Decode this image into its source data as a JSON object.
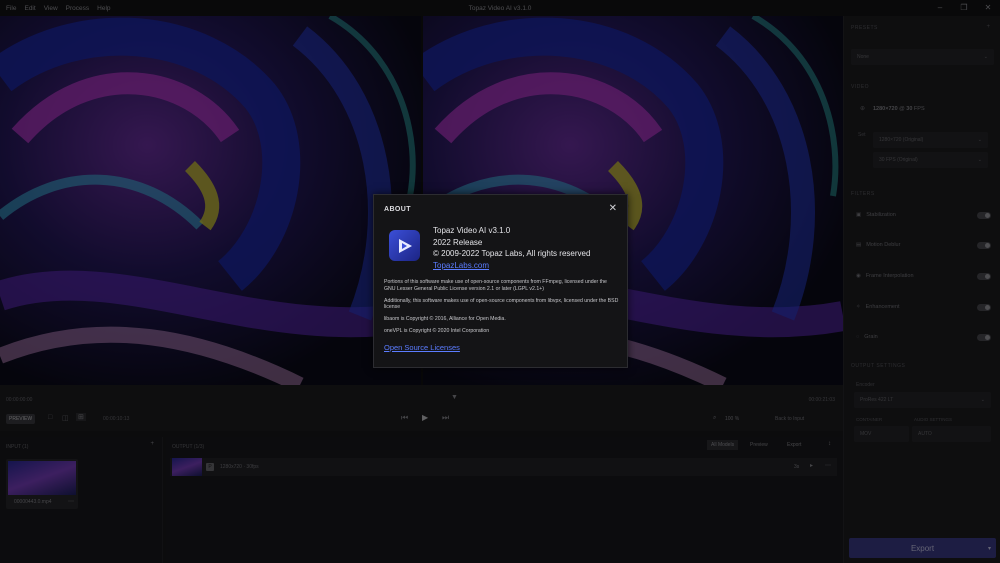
{
  "window": {
    "title": "Topaz Video AI v3.1.0",
    "menu": [
      "File",
      "Edit",
      "View",
      "Process",
      "Help"
    ],
    "controls": [
      "–",
      "❐",
      "✕"
    ]
  },
  "timeline": {
    "start": "00:00:00:00",
    "end": "00:00:21:03"
  },
  "controls": {
    "preview": "PREVIEW",
    "compare_modes": [
      "□",
      "◫",
      "⊞"
    ],
    "duration": "00:00:10:13",
    "zoom": "100 %",
    "back_to_input": "Back to Input"
  },
  "input": {
    "header": "INPUT (1)",
    "clip_name": "00000443.0.mp4"
  },
  "output": {
    "header": "OUTPUT (1/3)",
    "tabs": [
      "All Models",
      "Preview",
      "Export"
    ],
    "row_label": "1280x720 · 30fps",
    "row_badge": "3s"
  },
  "sidebar": {
    "presets_header": "PRESETS",
    "preset_value": "None",
    "video_header": "VIDEO",
    "video_res": "1280×720",
    "video_fps": "30",
    "video_fps_unit": "FPS",
    "set_label": "Set",
    "out_res": "1280×720 (Original)",
    "out_fps": "30 FPS (Original)",
    "filters_header": "FILTERS",
    "filters": [
      "Stabilization",
      "Motion Deblur",
      "Frame Interpolation",
      "Enhancement",
      "Grain"
    ],
    "output_settings_header": "OUTPUT SETTINGS",
    "encoder_label": "Encoder",
    "encoder_value": "ProRes 422 LT",
    "container_label": "CONTAINER",
    "container_value": "MOV",
    "audio_label": "AUDIO SETTINGS",
    "audio_value": "AUTO",
    "export_label": "Export"
  },
  "about": {
    "title": "ABOUT",
    "product": "Topaz Video AI  v3.1.0",
    "release": "2022 Release",
    "copyright": "© 2009-2022 Topaz Labs, All rights reserved",
    "website": "TopazLabs.com",
    "legal": [
      "Portions of this software make use of open-source components from FFmpeg, licensed under the GNU Lesser General Public License version 2.1 or later (LGPL v2.1+)",
      "Additionally, this software makes use of open-source components from libvpx, licensed under the BSD license",
      "libaom is Copyright © 2016, Alliance for Open Media.",
      "oneVPL is Copyright © 2020 Intel Corporation"
    ],
    "open_source_link": "Open Source Licenses"
  },
  "colors": {
    "accent": "#5b7cff",
    "export": "#3b3a86",
    "logo": "#3b4fd8"
  }
}
